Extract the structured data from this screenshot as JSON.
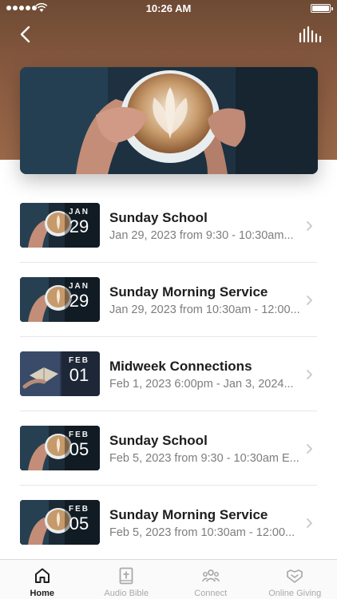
{
  "status_bar": {
    "time": "10:26 AM"
  },
  "header": {
    "back_icon": "chevron-left-icon",
    "audio_icon": "audio-bars-icon"
  },
  "events": [
    {
      "month": "JAN",
      "day": "29",
      "title": "Sunday School",
      "subtitle": "Jan 29, 2023 from 9:30 - 10:30am...",
      "image": "coffee"
    },
    {
      "month": "JAN",
      "day": "29",
      "title": "Sunday Morning Service",
      "subtitle": "Jan 29, 2023 from 10:30am - 12:00...",
      "image": "coffee"
    },
    {
      "month": "FEB",
      "day": "01",
      "title": "Midweek Connections",
      "subtitle": "Feb 1, 2023 6:00pm - Jan 3, 2024...",
      "image": "book"
    },
    {
      "month": "FEB",
      "day": "05",
      "title": "Sunday School",
      "subtitle": "Feb 5, 2023 from 9:30 - 10:30am E...",
      "image": "coffee"
    },
    {
      "month": "FEB",
      "day": "05",
      "title": "Sunday Morning Service",
      "subtitle": "Feb 5, 2023 from 10:30am - 12:00...",
      "image": "coffee"
    }
  ],
  "tab_bar": {
    "tabs": [
      {
        "label": "Home",
        "icon": "home-icon",
        "active": true
      },
      {
        "label": "Audio Bible",
        "icon": "bible-icon",
        "active": false
      },
      {
        "label": "Connect",
        "icon": "people-icon",
        "active": false
      },
      {
        "label": "Online Giving",
        "icon": "giving-heart-icon",
        "active": false
      }
    ]
  },
  "colors": {
    "header_brown": "#8c5d42",
    "active_tab": "#1d1d1d",
    "inactive_tab": "#a9a9a9",
    "subtitle_gray": "#7d7d7d"
  }
}
